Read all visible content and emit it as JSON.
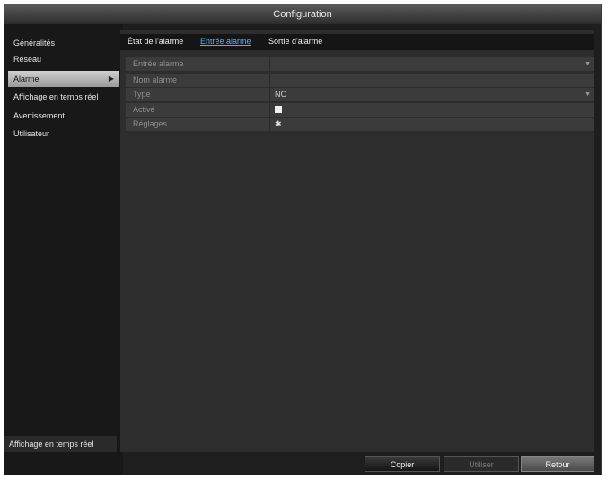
{
  "window": {
    "title": "Configuration"
  },
  "sidebar": {
    "items": [
      {
        "label": "Généralités"
      },
      {
        "label": "Réseau"
      },
      {
        "label": "Alarme",
        "active": true
      },
      {
        "label": "Affichage en temps réel"
      },
      {
        "label": "Avertissement"
      },
      {
        "label": "Utilisateur"
      }
    ],
    "bottom_label": "Affichage en temps réel"
  },
  "tabs": [
    {
      "label": "État de l'alarme"
    },
    {
      "label": "Entrée alarme",
      "active": true
    },
    {
      "label": "Sortie d'alarme"
    }
  ],
  "form": {
    "rows": [
      {
        "label": "Entrée alarme",
        "value": ""
      },
      {
        "label": "Nom alarme",
        "value": ""
      },
      {
        "label": "Type",
        "value": "NO"
      },
      {
        "label": "Activé",
        "checked": true
      },
      {
        "label": "Réglages",
        "icon": "gear-icon"
      }
    ]
  },
  "buttons": {
    "copy": "Copier",
    "use": "Utiliser",
    "back": "Retour"
  },
  "colors": {
    "active_tab": "#4fb3ff",
    "background": "#1e1e1e"
  }
}
